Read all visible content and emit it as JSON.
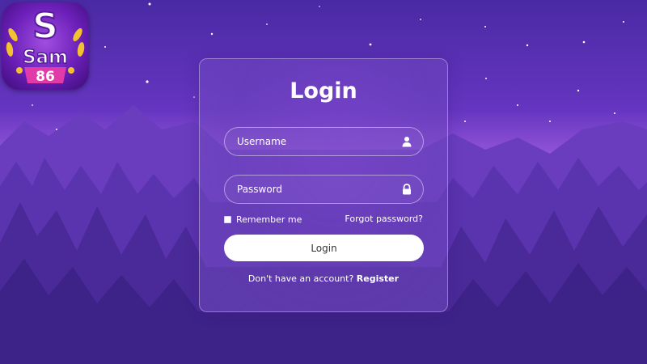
{
  "brand": {
    "logo_letter": "S",
    "logo_word": "Sam",
    "logo_number": "86"
  },
  "login": {
    "title": "Login",
    "username": {
      "placeholder": "Username",
      "value": ""
    },
    "password": {
      "placeholder": "Password",
      "value": ""
    },
    "remember_label": "Remember me",
    "forgot_label": "Forgot password?",
    "submit_label": "Login",
    "register_prompt": "Don't have an account?",
    "register_label": "Register"
  },
  "icons": {
    "username": "user-icon",
    "password": "lock-icon"
  },
  "colors": {
    "sky_top": "#4b2aa6",
    "glow": "#b06fe2",
    "forest": "#4a2a98",
    "button": "#ffffff"
  }
}
